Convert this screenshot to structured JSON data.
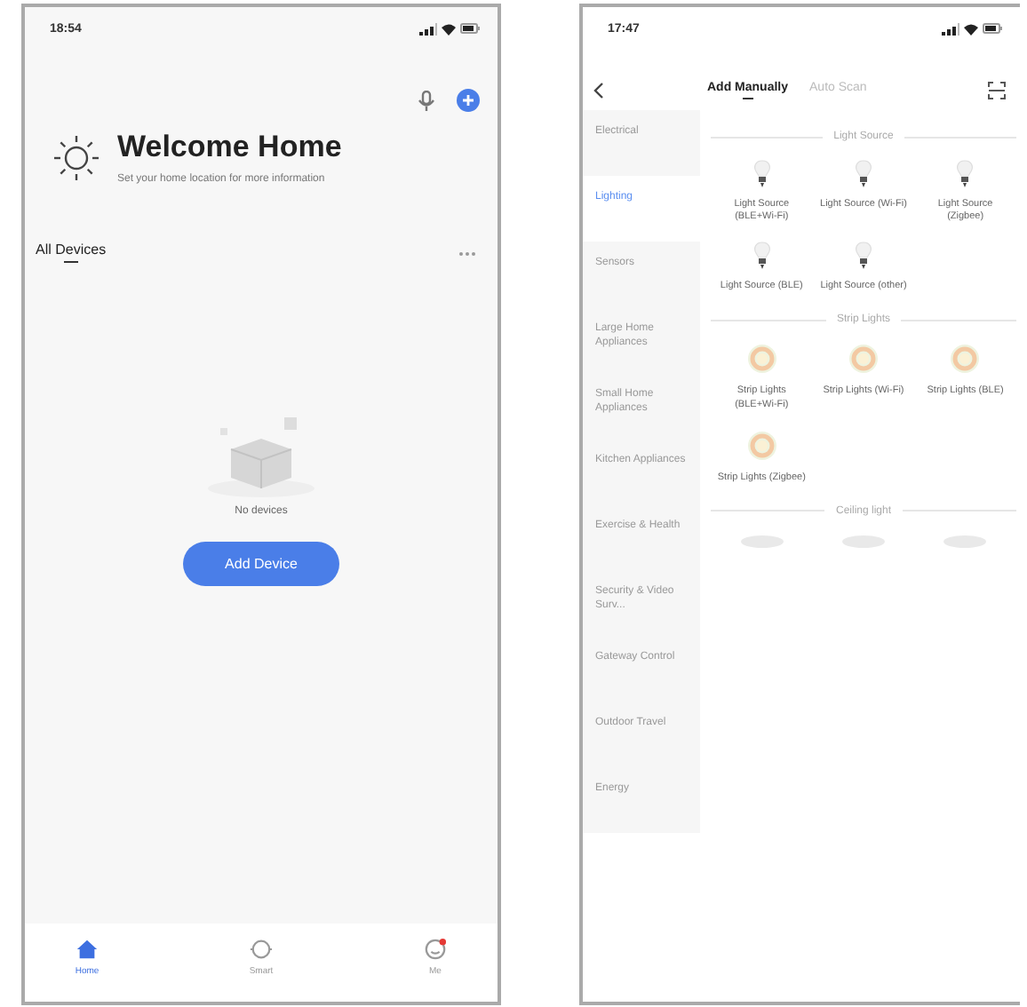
{
  "home_screen": {
    "status_bar": {
      "time": "18:54"
    },
    "header": {
      "title": "Welcome Home",
      "subtitle": "Set your home location for more information"
    },
    "section": {
      "title": "All Devices"
    },
    "empty_state": {
      "message": "No devices",
      "button": "Add Device"
    },
    "tab_bar": [
      {
        "label": "Home",
        "kind": "home",
        "selected": true
      },
      {
        "label": "Smart",
        "kind": "smart",
        "selected": false
      },
      {
        "label": "Me",
        "kind": "me",
        "selected": false
      }
    ]
  },
  "add_device_screen": {
    "status_bar": {
      "time": "17:47"
    },
    "tabs": [
      {
        "label": "Add Manually",
        "selected": true
      },
      {
        "label": "Auto Scan",
        "selected": false
      }
    ],
    "sidebar": [
      {
        "label": "Electrical",
        "selected": false
      },
      {
        "label": "Lighting",
        "selected": true
      },
      {
        "label": "Sensors",
        "selected": false
      },
      {
        "label": "Large Home Appliances",
        "selected": false
      },
      {
        "label": "Small Home Appliances",
        "selected": false
      },
      {
        "label": "Kitchen Appliances",
        "selected": false
      },
      {
        "label": "Exercise & Health",
        "selected": false
      },
      {
        "label": "Security & Video Surv...",
        "selected": false
      },
      {
        "label": "Gateway Control",
        "selected": false
      },
      {
        "label": "Outdoor Travel",
        "selected": false
      },
      {
        "label": "Energy",
        "selected": false
      }
    ],
    "groups": [
      {
        "title": "Light Source",
        "items": [
          {
            "kind": "bulb",
            "label": "Light Source (BLE+Wi-Fi)"
          },
          {
            "kind": "bulb",
            "label": "Light Source (Wi-Fi)"
          },
          {
            "kind": "bulb",
            "label": "Light Source (Zigbee)"
          },
          {
            "kind": "bulb",
            "label": "Light Source (BLE)"
          },
          {
            "kind": "bulb",
            "label": "Light Source (other)"
          }
        ]
      },
      {
        "title": "Strip Lights",
        "items": [
          {
            "kind": "strip",
            "label": "Strip Lights (BLE+Wi-Fi)"
          },
          {
            "kind": "strip",
            "label": "Strip Lights (Wi-Fi)"
          },
          {
            "kind": "strip",
            "label": "Strip Lights (BLE)"
          },
          {
            "kind": "strip",
            "label": "Strip Lights (Zigbee)"
          }
        ]
      },
      {
        "title": "Ceiling light",
        "items": [
          {
            "kind": "ceiling"
          },
          {
            "kind": "ceiling"
          },
          {
            "kind": "ceiling"
          }
        ]
      }
    ]
  }
}
